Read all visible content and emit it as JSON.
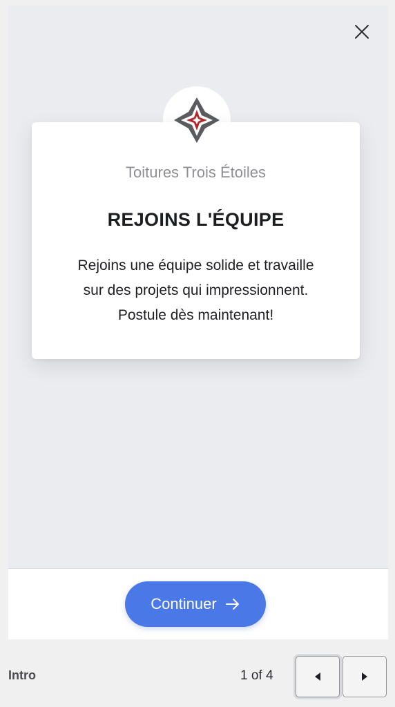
{
  "modal": {
    "company": "Toitures Trois Étoiles",
    "title": "REJOINS L'ÉQUIPE",
    "body_lines": [
      "Rejoins une équipe solide et travaille",
      "sur des projets qui impressionnent.",
      "Postule dès maintenant!"
    ],
    "continue_label": "Continuer",
    "continue_icon": "arrow-right-icon",
    "close_icon": "close-icon",
    "logo_icon": "four-point-star-logo"
  },
  "footer": {
    "label": "Intro",
    "page_indicator": "1 of 4",
    "prev_icon": "caret-left-icon",
    "next_icon": "caret-right-icon"
  },
  "colors": {
    "accent": "#4a78e6",
    "logo_dark": "#5a5b5f",
    "logo_red": "#b3262b",
    "background": "#ebecef"
  }
}
